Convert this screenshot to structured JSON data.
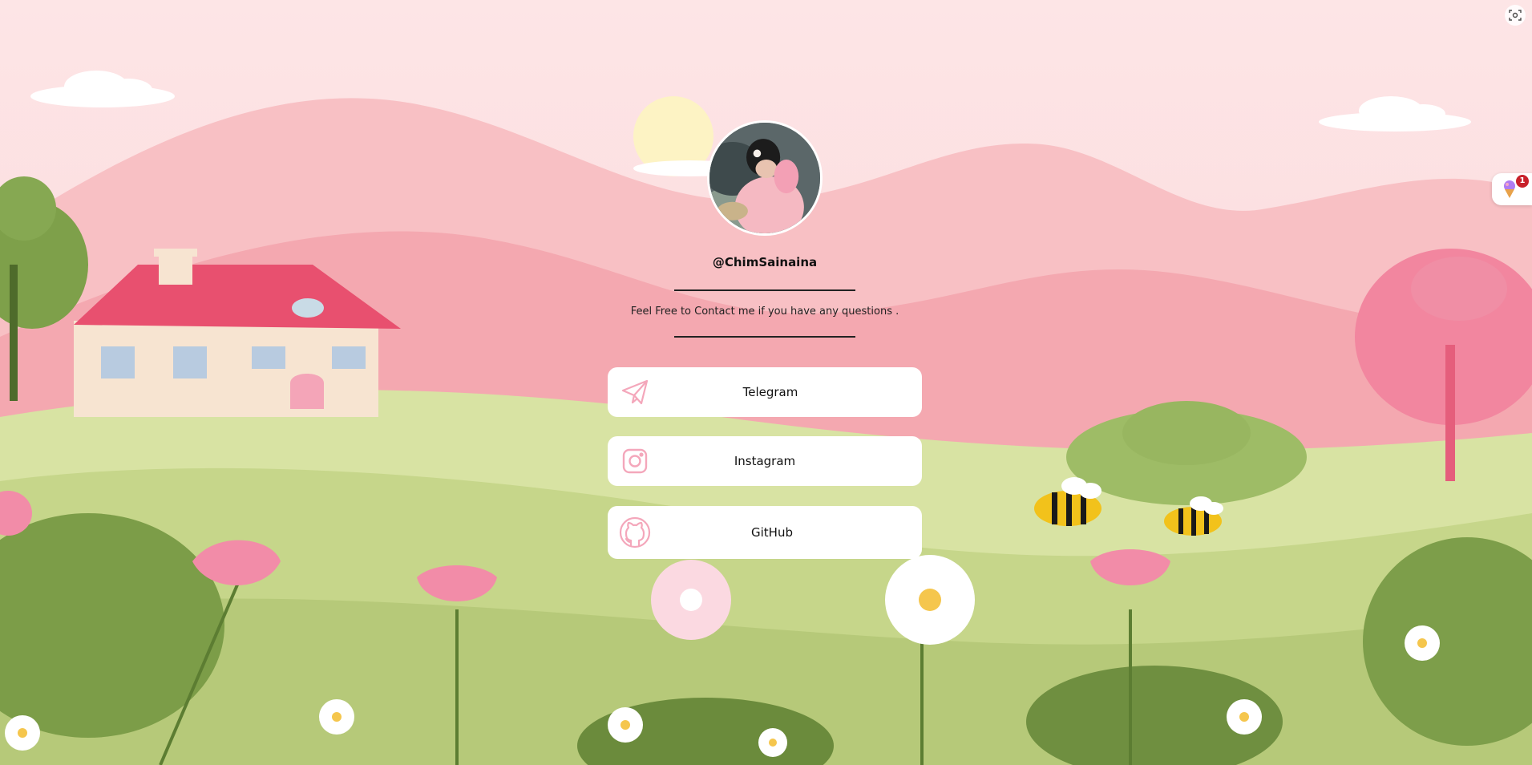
{
  "profile": {
    "username": "@ChimSainaina",
    "tagline": "Feel Free to Contact me if you have any questions ."
  },
  "links": [
    {
      "label": "Telegram",
      "icon": "telegram-icon"
    },
    {
      "label": "Instagram",
      "icon": "instagram-icon"
    },
    {
      "label": "GitHub",
      "icon": "github-icon"
    }
  ],
  "extension": {
    "badge_count": "1"
  },
  "colors": {
    "accent_pink": "#f4a7bb",
    "card_bg": "#ffffff",
    "sky": "#fde0e2",
    "grass": "#c9d98c"
  }
}
